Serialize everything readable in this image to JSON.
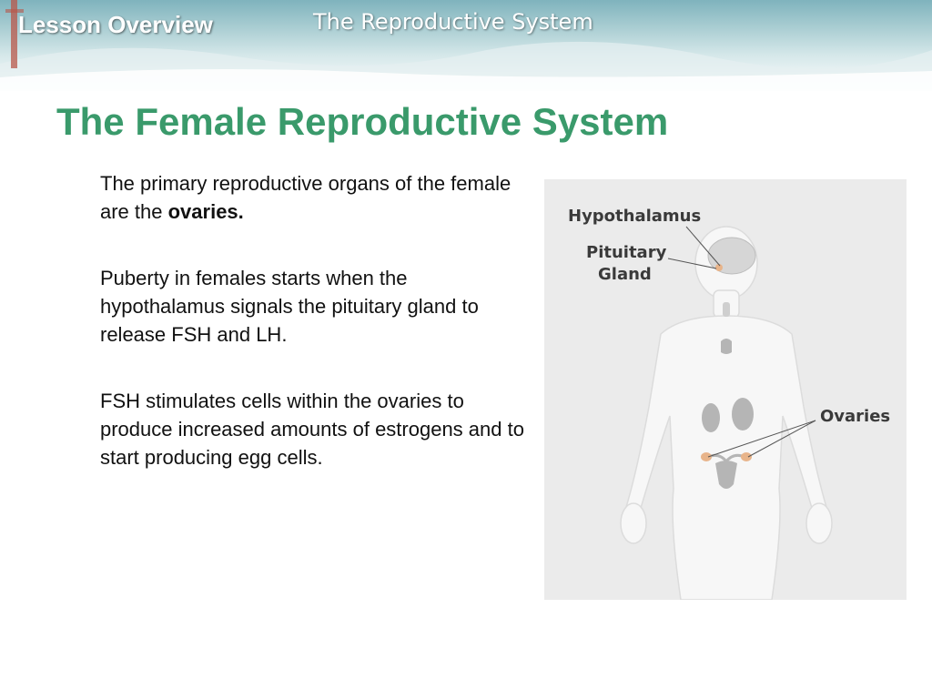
{
  "header": {
    "lesson_label": "Lesson Overview",
    "deck_title": "The Reproductive System"
  },
  "slide": {
    "title": "The Female Reproductive System",
    "paragraphs": [
      {
        "text": "The primary reproductive organs of the female are the ",
        "bold": "ovaries."
      },
      {
        "text": "Puberty in females starts when the hypothalamus signals the pituitary gland to release FSH and LH."
      },
      {
        "text": "FSH stimulates cells within the ovaries to produce increased amounts of estrogens and to start producing egg cells."
      }
    ]
  },
  "figure": {
    "labels": {
      "hypothalamus": "Hypothalamus",
      "pituitary_line1": "Pituitary",
      "pituitary_line2": "Gland",
      "ovaries": "Ovaries"
    },
    "colors": {
      "background": "#ebebeb",
      "body": "#f7f7f7",
      "organ": "#b5b5b5",
      "highlight": "#e8b48a",
      "label": "#3a3a3a"
    }
  },
  "colors": {
    "title": "#3a9a6b",
    "header_text": "#ffffff"
  }
}
